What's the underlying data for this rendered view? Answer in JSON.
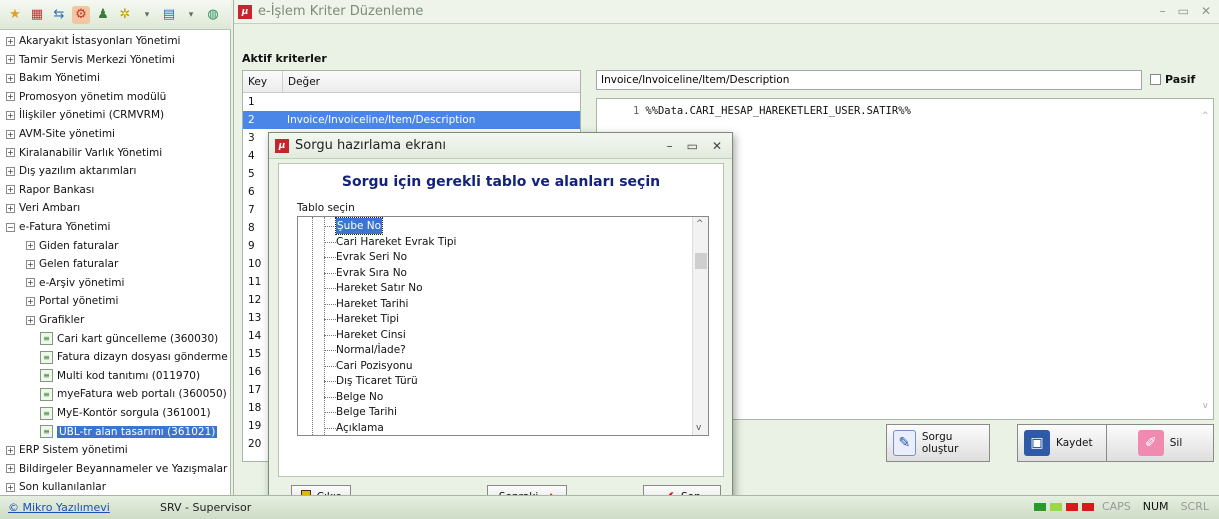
{
  "toolbar": {
    "icons": [
      "star-icon",
      "calendar-icon",
      "switch-icon",
      "gear-icon",
      "user-icon",
      "spark-icon",
      "grid-icon",
      "globe-icon"
    ]
  },
  "tree": [
    {
      "label": "Akaryakıt İstasyonları Yönetimi",
      "level": 0,
      "type": "plus"
    },
    {
      "label": "Tamir Servis Merkezi Yönetimi",
      "level": 0,
      "type": "plus"
    },
    {
      "label": "Bakım Yönetimi",
      "level": 0,
      "type": "plus"
    },
    {
      "label": "Promosyon yönetim modülü",
      "level": 0,
      "type": "plus"
    },
    {
      "label": "İlişkiler yönetimi (CRMVRM)",
      "level": 0,
      "type": "plus"
    },
    {
      "label": "AVM-Site yönetimi",
      "level": 0,
      "type": "plus"
    },
    {
      "label": "Kiralanabilir Varlık Yönetimi",
      "level": 0,
      "type": "plus"
    },
    {
      "label": "Dış yazılım aktarımları",
      "level": 0,
      "type": "plus"
    },
    {
      "label": "Rapor Bankası",
      "level": 0,
      "type": "plus"
    },
    {
      "label": "Veri Ambarı",
      "level": 0,
      "type": "plus"
    },
    {
      "label": "e-Fatura Yönetimi",
      "level": 0,
      "type": "minus"
    },
    {
      "label": "Giden faturalar",
      "level": 1,
      "type": "plus"
    },
    {
      "label": "Gelen faturalar",
      "level": 1,
      "type": "plus"
    },
    {
      "label": "e-Arşiv yönetimi",
      "level": 1,
      "type": "plus"
    },
    {
      "label": "Portal yönetimi",
      "level": 1,
      "type": "plus"
    },
    {
      "label": "Grafikler",
      "level": 1,
      "type": "plus"
    },
    {
      "label": "Cari kart güncelleme (360030)",
      "level": 2,
      "type": "leaf"
    },
    {
      "label": "Fatura dizayn dosyası gönderme (3(",
      "level": 2,
      "type": "leaf"
    },
    {
      "label": "Multi kod tanıtımı (011970)",
      "level": 2,
      "type": "leaf"
    },
    {
      "label": "myeFatura web portalı (360050)",
      "level": 2,
      "type": "leaf"
    },
    {
      "label": "MyE-Kontör sorgula (361001)",
      "level": 2,
      "type": "leaf"
    },
    {
      "label": "UBL-tr alan tasarımı (361021)",
      "level": 2,
      "type": "leaf",
      "selected": true
    },
    {
      "label": "ERP Sistem yönetimi",
      "level": 0,
      "type": "plus"
    },
    {
      "label": "Bildirgeler Beyannameler ve Yazışmalar",
      "level": 0,
      "type": "plus"
    },
    {
      "label": "Son kullanılanlar",
      "level": 0,
      "type": "plus"
    }
  ],
  "status": {
    "company": "© Mikro Yazılımevi",
    "user": "SRV - Supervisor",
    "caps": "CAPS",
    "num": "NUM",
    "scrl": "SCRL"
  },
  "main": {
    "title": "e-İşlem Kriter Düzenleme",
    "criteria_title": "Aktif kriterler",
    "col_key": "Key",
    "col_value": "Değer",
    "rows": [
      {
        "key": "1",
        "value": ""
      },
      {
        "key": "2",
        "value": "Invoice/Invoiceline/Item/Description",
        "selected": true
      },
      {
        "key": "3",
        "value": ""
      },
      {
        "key": "4",
        "value": ""
      },
      {
        "key": "5",
        "value": ""
      },
      {
        "key": "6",
        "value": ""
      },
      {
        "key": "7",
        "value": ""
      },
      {
        "key": "8",
        "value": ""
      },
      {
        "key": "9",
        "value": ""
      },
      {
        "key": "10",
        "value": ""
      },
      {
        "key": "11",
        "value": ""
      },
      {
        "key": "12",
        "value": ""
      },
      {
        "key": "13",
        "value": ""
      },
      {
        "key": "14",
        "value": ""
      },
      {
        "key": "15",
        "value": ""
      },
      {
        "key": "16",
        "value": ""
      },
      {
        "key": "17",
        "value": ""
      },
      {
        "key": "18",
        "value": ""
      },
      {
        "key": "19",
        "value": ""
      },
      {
        "key": "20",
        "value": ""
      }
    ],
    "path_value": "Invoice/Invoiceline/Item/Description",
    "pasif_label": "Pasif",
    "code_line_no": "1",
    "code_text": "%%Data.CARI_HESAP_HAREKETLERI_USER.SATIR%%",
    "btn_sorgu": "Sorgu oluştur",
    "btn_kaydet": "Kaydet",
    "btn_sil": "Sil"
  },
  "dialog": {
    "title": "Sorgu hazırlama ekranı",
    "heading": "Sorgu için gerekli tablo ve alanları seçin",
    "table_label": "Tablo seçin",
    "fields": [
      {
        "label": "Şube No",
        "selected": true
      },
      {
        "label": "Cari Hareket Evrak Tipi"
      },
      {
        "label": "Evrak Seri No"
      },
      {
        "label": "Evrak Sıra No"
      },
      {
        "label": "Hareket Satır No"
      },
      {
        "label": "Hareket Tarihi"
      },
      {
        "label": "Hareket Tipi"
      },
      {
        "label": "Hareket Cinsi"
      },
      {
        "label": "Normal/İade?"
      },
      {
        "label": "Cari Pozisyonu"
      },
      {
        "label": "Dış Ticaret Türü"
      },
      {
        "label": "Belge No"
      },
      {
        "label": "Belge Tarihi"
      },
      {
        "label": "Açıklama"
      }
    ],
    "btn_exit": "Çıkış",
    "btn_next": "Sonraki",
    "btn_finish": "Son"
  }
}
